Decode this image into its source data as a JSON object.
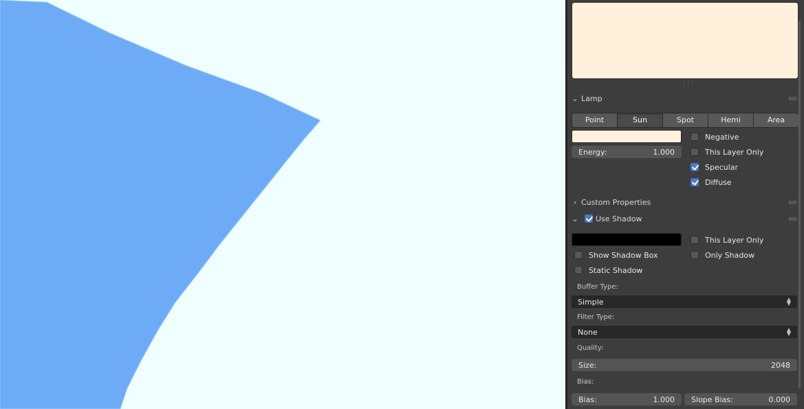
{
  "colors": {
    "viewport_bg": "#f0ffff",
    "plane": "#6eabf6",
    "lamp_color": "#fff1dc",
    "shadow_color": "#000000",
    "panel_bg": "#3d3d3d",
    "accent": "#4a7dc4"
  },
  "lamp": {
    "title": "Lamp",
    "tabs": [
      {
        "label": "Point",
        "active": false
      },
      {
        "label": "Sun",
        "active": true
      },
      {
        "label": "Spot",
        "active": false
      },
      {
        "label": "Hemi",
        "active": false
      },
      {
        "label": "Area",
        "active": false
      }
    ],
    "energy_label": "Energy:",
    "energy_value": "1.000",
    "negative": {
      "label": "Negative",
      "checked": false
    },
    "this_layer_only": {
      "label": "This Layer Only",
      "checked": false
    },
    "specular": {
      "label": "Specular",
      "checked": true
    },
    "diffuse": {
      "label": "Diffuse",
      "checked": true
    }
  },
  "custom_properties": {
    "title": "Custom Properties"
  },
  "shadow": {
    "title": "Use Shadow",
    "use_shadow_checked": true,
    "this_layer_only": {
      "label": "This Layer Only",
      "checked": false
    },
    "show_shadow_box": {
      "label": "Show Shadow Box",
      "checked": false
    },
    "only_shadow": {
      "label": "Only Shadow",
      "checked": false
    },
    "static_shadow": {
      "label": "Static Shadow",
      "checked": false
    },
    "buffer_type_label": "Buffer Type:",
    "buffer_type_value": "Simple",
    "filter_type_label": "Filter Type:",
    "filter_type_value": "None",
    "quality_label": "Quality:",
    "size_label": "Size:",
    "size_value": "2048",
    "bias_heading": "Bias:",
    "bias_label": "Bias:",
    "bias_value": "1.000",
    "slope_bias_label": "Slope Bias:",
    "slope_bias_value": "0.000"
  }
}
